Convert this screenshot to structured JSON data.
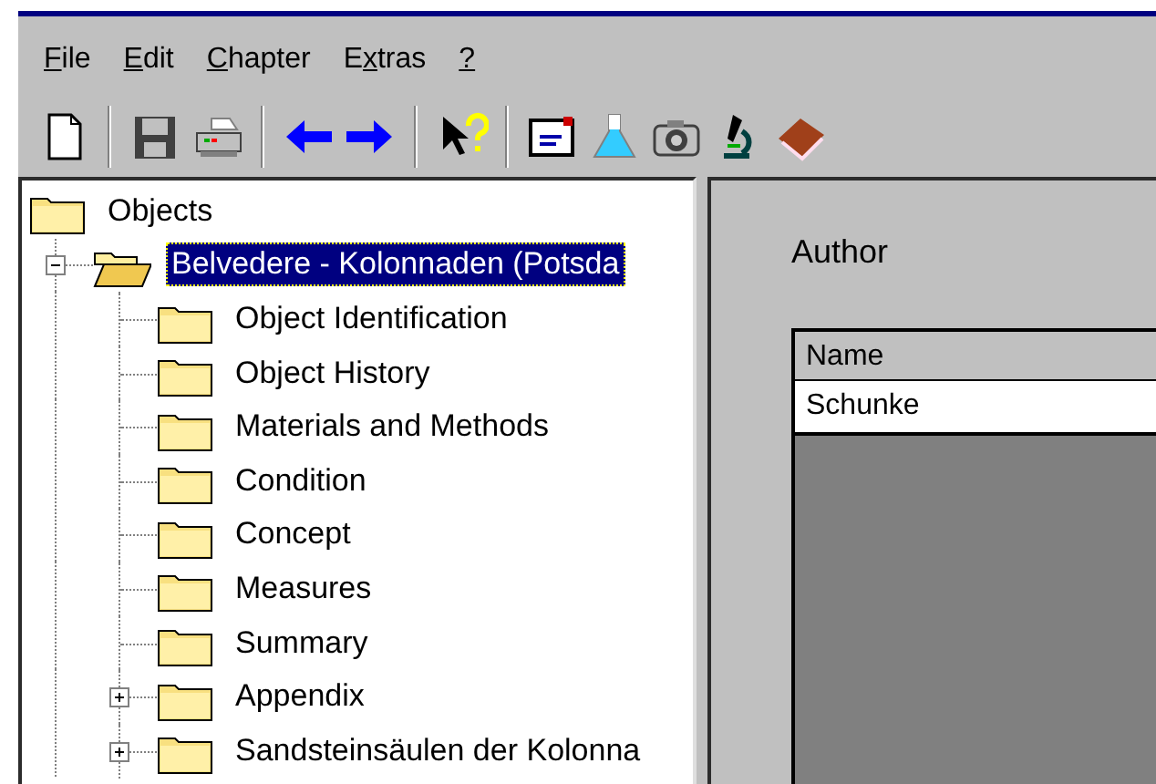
{
  "menu": [
    {
      "key": "F",
      "after": "ile"
    },
    {
      "key": "E",
      "after": "dit"
    },
    {
      "key": "C",
      "after": "hapter"
    },
    {
      "before": "E",
      "key": "x",
      "after": "tras"
    },
    {
      "key": "?"
    }
  ],
  "toolbar": [
    {
      "kind": "new"
    },
    {
      "kind": "separator"
    },
    {
      "kind": "save"
    },
    {
      "kind": "print"
    },
    {
      "kind": "separator"
    },
    {
      "kind": "back"
    },
    {
      "kind": "forward"
    },
    {
      "kind": "separator"
    },
    {
      "kind": "help"
    },
    {
      "kind": "separator"
    },
    {
      "kind": "note"
    },
    {
      "kind": "flask"
    },
    {
      "kind": "camera"
    },
    {
      "kind": "microscope"
    },
    {
      "kind": "book"
    }
  ],
  "tree": [
    {
      "label": "Objects",
      "open": false,
      "selected": false,
      "children": [
        {
          "label": "Belvedere - Kolonnaden (Potsda",
          "open": true,
          "selected": true,
          "expanded": true,
          "children": [
            {
              "label": "Object Identification",
              "open": false,
              "selected": false
            },
            {
              "label": "Object History",
              "open": false,
              "selected": false
            },
            {
              "label": "Materials and Methods",
              "open": false,
              "selected": false
            },
            {
              "label": "Condition",
              "open": false,
              "selected": false
            },
            {
              "label": "Concept",
              "open": false,
              "selected": false
            },
            {
              "label": "Measures",
              "open": false,
              "selected": false
            },
            {
              "label": "Summary",
              "open": false,
              "selected": false
            },
            {
              "label": "Appendix",
              "open": false,
              "selected": false,
              "expanded": false
            },
            {
              "label": "Sandsteinsäulen der Kolonna",
              "open": false,
              "selected": false,
              "expanded": false
            }
          ]
        }
      ]
    }
  ],
  "detail": {
    "title": "Author",
    "table": {
      "columns": [
        "Name"
      ],
      "rows": [
        [
          "Schunke"
        ]
      ]
    }
  }
}
